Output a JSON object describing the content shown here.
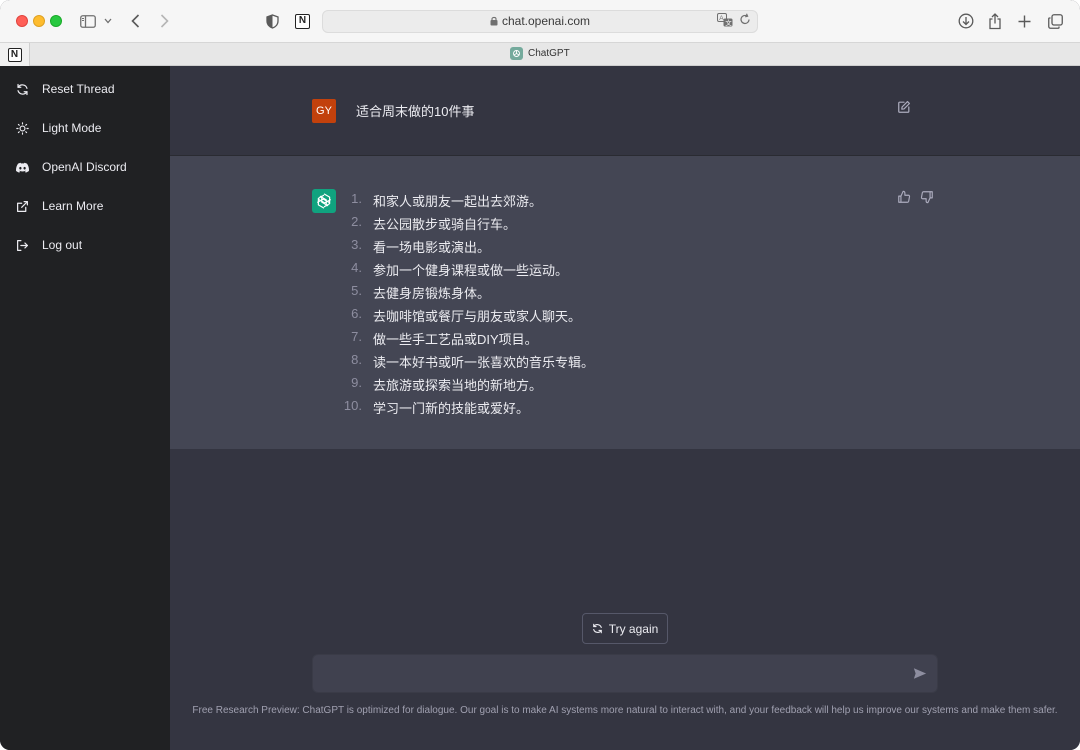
{
  "browser": {
    "url": "chat.openai.com",
    "tab_title": "ChatGPT"
  },
  "sidebar": {
    "items": [
      {
        "label": "Reset Thread",
        "icon": "refresh-icon"
      },
      {
        "label": "Light Mode",
        "icon": "sun-icon"
      },
      {
        "label": "OpenAI Discord",
        "icon": "discord-icon"
      },
      {
        "label": "Learn More",
        "icon": "external-link-icon"
      },
      {
        "label": "Log out",
        "icon": "logout-icon"
      }
    ]
  },
  "conversation": {
    "user": {
      "initials": "GY",
      "message": "适合周末做的10件事"
    },
    "assistant": {
      "items": [
        {
          "num": "1.",
          "text": "和家人或朋友一起出去郊游。"
        },
        {
          "num": "2.",
          "text": "去公园散步或骑自行车。"
        },
        {
          "num": "3.",
          "text": "看一场电影或演出。"
        },
        {
          "num": "4.",
          "text": "参加一个健身课程或做一些运动。"
        },
        {
          "num": "5.",
          "text": "去健身房锻炼身体。"
        },
        {
          "num": "6.",
          "text": "去咖啡馆或餐厅与朋友或家人聊天。"
        },
        {
          "num": "7.",
          "text": "做一些手工艺品或DIY项目。"
        },
        {
          "num": "8.",
          "text": "读一本好书或听一张喜欢的音乐专辑。"
        },
        {
          "num": "9.",
          "text": "去旅游或探索当地的新地方。"
        },
        {
          "num": "10.",
          "text": "学习一门新的技能或爱好。"
        }
      ]
    }
  },
  "composer": {
    "try_again_label": "Try again",
    "input_value": "",
    "footer": "Free Research Preview: ChatGPT is optimized for dialogue. Our goal is to make AI systems more natural to interact with, and your feedback will help us improve our systems and make them safer."
  },
  "colors": {
    "sidebar_bg": "#202123",
    "main_bg": "#343541",
    "assistant_bg": "#444654",
    "user_avatar": "#c2410c",
    "bot_avatar": "#10a37f"
  }
}
